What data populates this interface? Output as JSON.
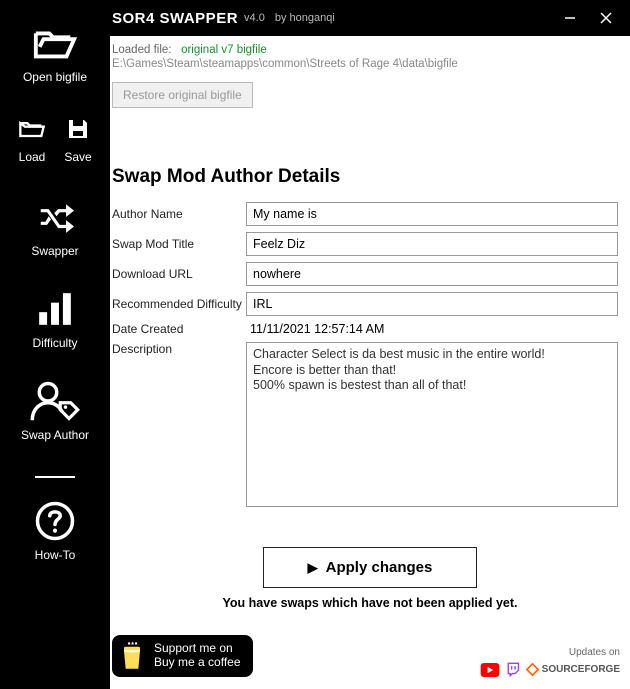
{
  "titlebar": {
    "title": "SOR4 SWAPPER",
    "version": "v4.0",
    "author": "by honganqi"
  },
  "sidebar": {
    "open": "Open bigfile",
    "load": "Load",
    "save": "Save",
    "swapper": "Swapper",
    "difficulty": "Difficulty",
    "swap_author": "Swap Author",
    "howto": "How-To"
  },
  "meta": {
    "loaded_label": "Loaded file:",
    "filename": "original v7 bigfile",
    "path": "E:\\Games\\Steam\\steamapps\\common\\Streets of Rage 4\\data\\bigfile",
    "restore": "Restore original bigfile"
  },
  "section_title": "Swap Mod Author Details",
  "form": {
    "labels": {
      "author": "Author Name",
      "title": "Swap Mod Title",
      "url": "Download URL",
      "diff": "Recommended Difficulty",
      "date": "Date Created",
      "desc": "Description"
    },
    "values": {
      "author": "My name is",
      "title": "Feelz Diz",
      "url": "nowhere",
      "diff": "IRL",
      "date": "11/11/2021 12:57:14 AM",
      "desc": "Character Select is da best music in the entire world!\nEncore is better than that!\n500% spawn is bestest than all of that!"
    }
  },
  "apply": {
    "label": "Apply changes",
    "warning": "You have swaps which have not been applied yet."
  },
  "footer": {
    "bmc_line1": "Support me on",
    "bmc_line2": "Buy me a coffee",
    "updates_label": "Updates on",
    "sourceforge": "SOURCEFORGE"
  }
}
